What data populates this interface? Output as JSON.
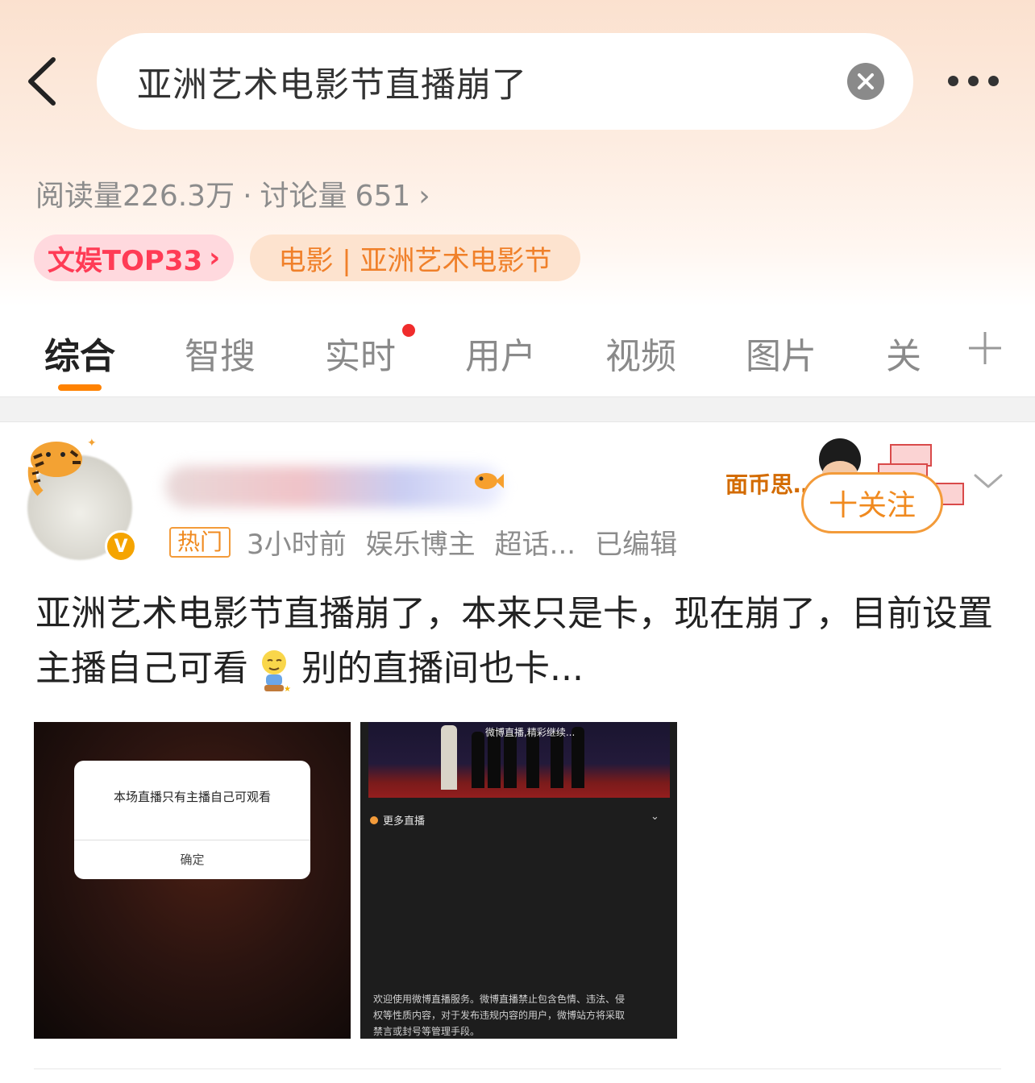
{
  "search": {
    "query": "亚洲艺术电影节直播崩了"
  },
  "stats": {
    "reads_label": "阅读量",
    "reads_value": "226.3万",
    "separator": "·",
    "discuss_label": "讨论量",
    "discuss_value": "651",
    "chevron": "›"
  },
  "tags": {
    "rank": "文娱TOP33",
    "rank_chevron": "›",
    "category": "电影 | 亚洲艺术电影节"
  },
  "tabs": [
    {
      "label": "综合",
      "active": true
    },
    {
      "label": "智搜"
    },
    {
      "label": "实时",
      "has_dot": true
    },
    {
      "label": "用户"
    },
    {
      "label": "视频"
    },
    {
      "label": "图片"
    },
    {
      "label": "关"
    }
  ],
  "post": {
    "author_verified_badge": "V",
    "hot_badge": "热门",
    "time": "3小时前",
    "author_type": "娱乐博主",
    "super_topic": "超话...",
    "edited": "已编辑",
    "follow_label": "十关注",
    "sticker_text": "面币思…",
    "text_part1": "亚洲艺术电影节直播崩了，本来只是卡，现在崩了，目前设置主播自己可看",
    "text_part2": "别的直播间也卡...",
    "images": [
      {
        "dialog_message": "本场直播只有主播自己可观看",
        "dialog_button": "确定"
      },
      {
        "stage_caption": "微博直播,精彩继续...",
        "more_live": "更多直播",
        "notice": "欢迎使用微博直播服务。微博直播禁止包含色情、违法、侵权等性质内容，对于发布违规内容的用户，微博站方将采取禁言或封号等管理手段。"
      }
    ]
  },
  "icons": {
    "back": "chevron-left-icon",
    "clear": "close-circle-icon",
    "more": "more-dots-icon",
    "add_tab": "plus-icon",
    "dropdown": "chevron-down-icon"
  },
  "colors": {
    "accent": "#ff8200",
    "rank_tag": "#ff3b55",
    "category_tag": "#f0802a",
    "dot": "#f02c2c"
  }
}
